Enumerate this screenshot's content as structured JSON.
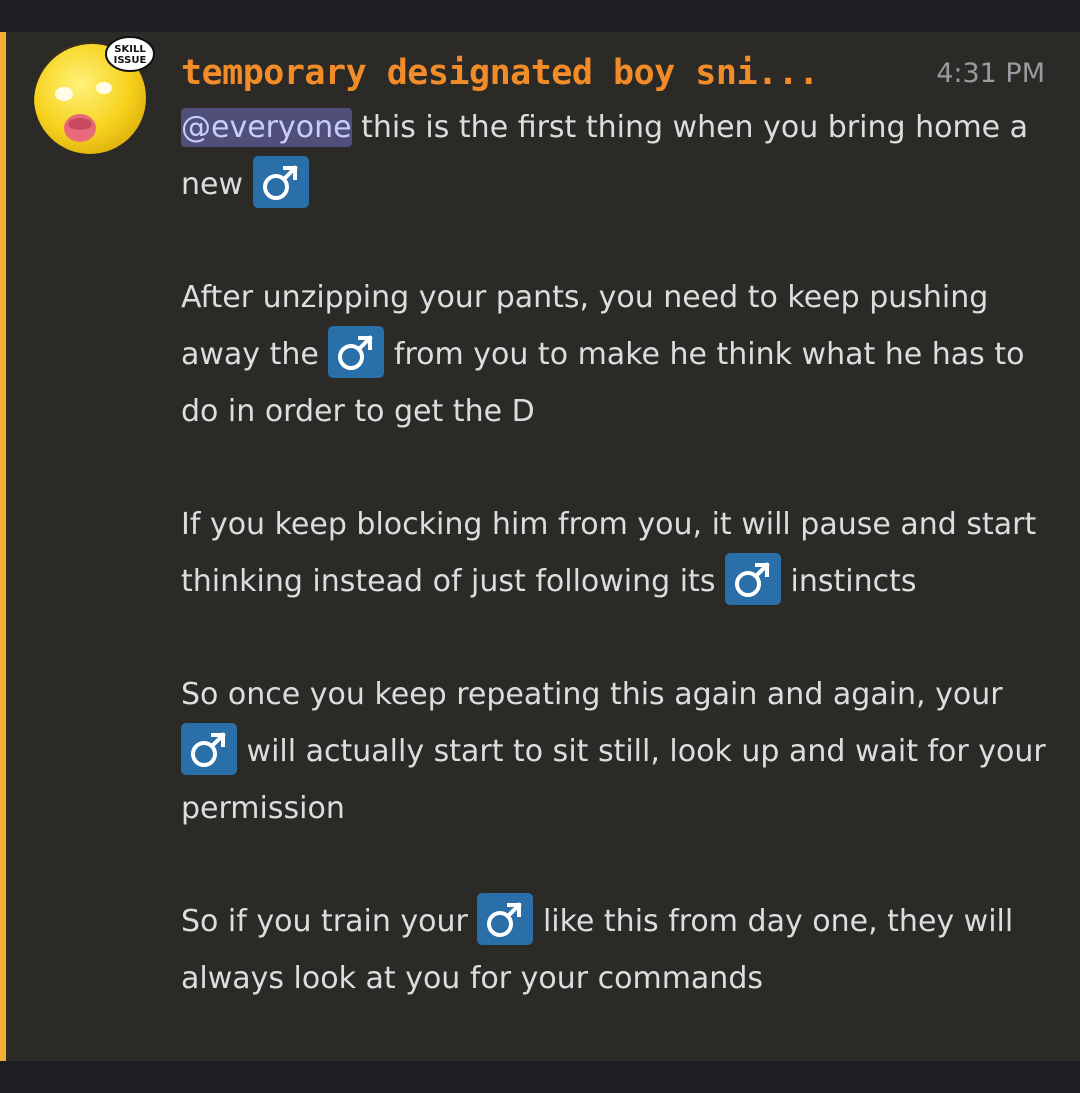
{
  "message": {
    "username": "temporary designated boy sni...",
    "timestamp": "4:31 PM",
    "avatar_icon": "yellow-face-tongue-out-icon",
    "avatar_badge": "SKILL ISSUE",
    "mention": "@everyone",
    "emoji_name": "male-sign-emoji",
    "colors": {
      "mention_bar": "#f0b132",
      "username": "#f28c28",
      "mention_bg": "#4f4f7a",
      "emoji_bg": "#2a6fa8"
    },
    "paragraphs": [
      {
        "a": "this is the first thing when you bring home a new"
      },
      {
        "a": "After unzipping your pants, you need to keep pushing away the",
        "b": "from you to make he think what he has to do in order to get the D"
      },
      {
        "a": "If you keep blocking him from you, it will pause and start thinking instead of just following its",
        "b": "instincts"
      },
      {
        "a": "So once you keep repeating this again and again, your",
        "b": "will actually start to sit still, look up and wait for your permission"
      },
      {
        "a": "So if you train your",
        "b": "like this from day one, they will always look at you for your commands"
      }
    ]
  }
}
